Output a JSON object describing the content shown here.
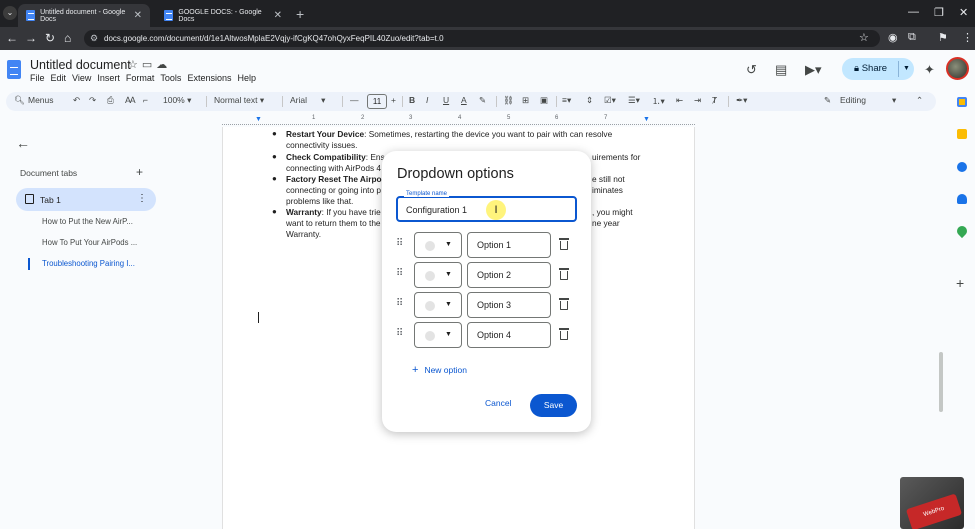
{
  "browser": {
    "tabs": [
      {
        "title": "Untitled document - Google Docs",
        "active": true
      },
      {
        "title": "GOOGLE DOCS: - Google Docs",
        "active": false
      }
    ],
    "url": "docs.google.com/document/d/1e1AltwosMplaE2Vqjy-ifCgKQ47ohQyxFeqPIL40Zuo/edit?tab=t.0"
  },
  "docs": {
    "title": "Untitled document",
    "menu": [
      "File",
      "Edit",
      "View",
      "Insert",
      "Format",
      "Tools",
      "Extensions",
      "Help"
    ],
    "share_label": "Share"
  },
  "toolbar": {
    "menus_label": "Menus",
    "zoom": "100%",
    "style": "Normal text",
    "font": "Arial",
    "font_size": "11",
    "mode": "Editing"
  },
  "ruler_numbers": [
    "1",
    "2",
    "3",
    "4",
    "5",
    "6",
    "7"
  ],
  "left_panel": {
    "section_label": "Document tabs",
    "tab_name": "Tab 1",
    "outline": [
      "How to Put the New AirP...",
      "How To Put Your AirPods ...",
      "Troubleshooting Pairing I..."
    ]
  },
  "document": {
    "lines": [
      {
        "bold": "Restart Your Device",
        "rest": ": Sometimes, restarting the device you want to pair with can resolve"
      },
      {
        "bold": "",
        "rest": "connectivity issues."
      },
      {
        "bold": "Check Compatibility",
        "rest": ": Ens"
      },
      {
        "bold": "",
        "rest": "connecting with AirPods 4"
      },
      {
        "bold": "Factory Reset The Airpo",
        "rest": ""
      },
      {
        "bold": "",
        "rest": "connecting or going into p"
      },
      {
        "bold": "",
        "rest": "problems like that."
      },
      {
        "bold": "Warranty",
        "rest": ": If you have trie"
      },
      {
        "bold": "",
        "rest": "want to return them to the"
      },
      {
        "bold": "",
        "rest": "Warranty."
      }
    ],
    "right_fragments": [
      "uirements for",
      "e still not",
      "iminates",
      ", you might",
      "ne year"
    ]
  },
  "dialog": {
    "title": "Dropdown options",
    "template_label": "Template name",
    "template_value": "Configuration 1",
    "options": [
      "Option 1",
      "Option 2",
      "Option 3",
      "Option 4"
    ],
    "new_option_label": "New option",
    "cancel_label": "Cancel",
    "save_label": "Save"
  },
  "watermark_text": "WebPro",
  "colors": {
    "accent": "#0b57d0",
    "share_bg": "#c2e7ff",
    "tab_selected_bg": "#d3e3fd"
  }
}
